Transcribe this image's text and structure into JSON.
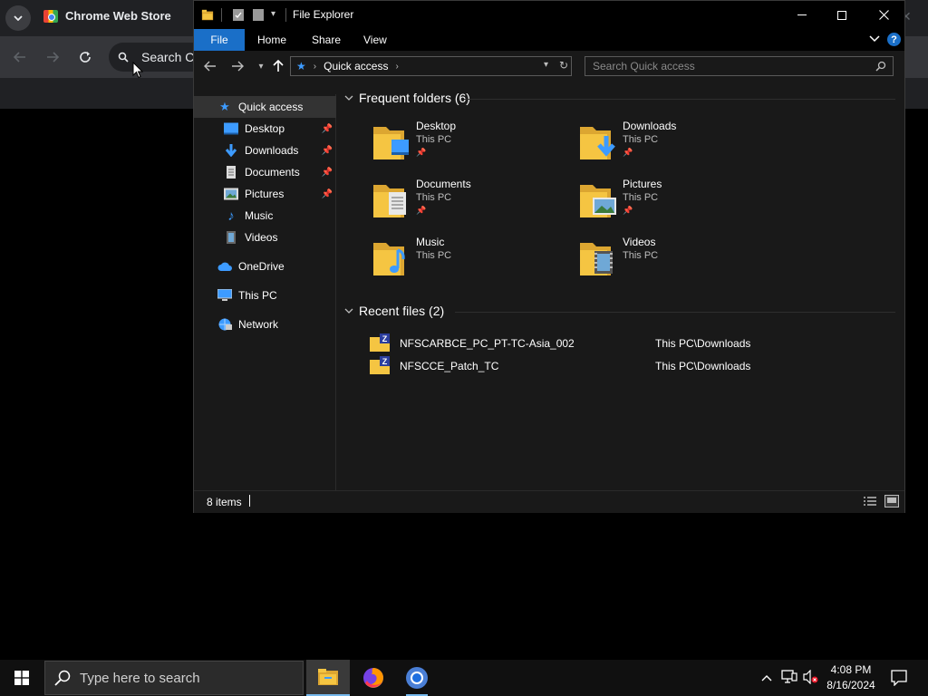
{
  "chrome": {
    "tab_title": "Chrome Web Store",
    "omnibox_text": "Search Co"
  },
  "explorer": {
    "title": "File Explorer",
    "ribbon_tabs": [
      "File",
      "Home",
      "Share",
      "View"
    ],
    "address": "Quick access",
    "search_placeholder": "Search Quick access",
    "nav": {
      "quick_access": "Quick access",
      "items": [
        "Desktop",
        "Downloads",
        "Documents",
        "Pictures",
        "Music",
        "Videos"
      ],
      "onedrive": "OneDrive",
      "this_pc": "This PC",
      "network": "Network"
    },
    "frequent_header": "Frequent folders (6)",
    "folders": [
      {
        "name": "Desktop",
        "loc": "This PC",
        "pinned": true,
        "icon": "desktop-folder-icon"
      },
      {
        "name": "Downloads",
        "loc": "This PC",
        "pinned": true,
        "icon": "downloads-folder-icon"
      },
      {
        "name": "Documents",
        "loc": "This PC",
        "pinned": true,
        "icon": "documents-folder-icon"
      },
      {
        "name": "Pictures",
        "loc": "This PC",
        "pinned": true,
        "icon": "pictures-folder-icon"
      },
      {
        "name": "Music",
        "loc": "This PC",
        "pinned": false,
        "icon": "music-folder-icon"
      },
      {
        "name": "Videos",
        "loc": "This PC",
        "pinned": false,
        "icon": "videos-folder-icon"
      }
    ],
    "recent_header": "Recent files (2)",
    "recent": [
      {
        "name": "NFSCARBCE_PC_PT-TC-Asia_002",
        "path": "This PC\\Downloads"
      },
      {
        "name": "NFSCCE_Patch_TC",
        "path": "This PC\\Downloads"
      }
    ],
    "status": "8 items"
  },
  "taskbar": {
    "search_placeholder": "Type here to search",
    "time": "4:08 PM",
    "date": "8/16/2024"
  },
  "colors": {
    "accent": "#1a6fc8",
    "folder_yellow": "#f5c542",
    "folder_dark": "#dca631"
  }
}
